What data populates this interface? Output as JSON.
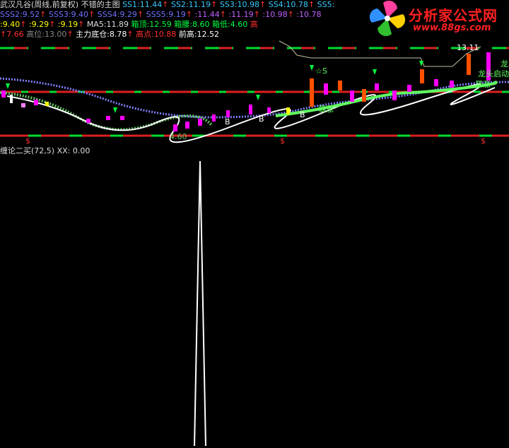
{
  "header": {
    "title": "武汉凡谷(周线,前复权) 不错的主图",
    "ss": [
      {
        "label": "SS1:",
        "value": "11.44"
      },
      {
        "label": "SS2:",
        "value": "11.19"
      },
      {
        "label": "SS3:",
        "value": "10.98"
      },
      {
        "label": "SS4:",
        "value": "10.78"
      },
      {
        "label": "SS5:",
        "value": ""
      }
    ],
    "sss": [
      {
        "label": "SSS2:",
        "value": "9.52"
      },
      {
        "label": "SSS3:",
        "value": "9.40"
      },
      {
        "label": "SSS4:",
        "value": "9.29"
      },
      {
        "label": "SSS5:",
        "value": "9.19"
      },
      {
        "label": ":",
        "value": "11.44"
      },
      {
        "label": ":",
        "value": "11.19"
      },
      {
        "label": ":",
        "value": "10.98"
      },
      {
        "label": ":",
        "value": "10.78"
      }
    ],
    "row3": [
      {
        "label": ":",
        "value": "9.40"
      },
      {
        "label": ":",
        "value": "9.29"
      },
      {
        "label": ":",
        "value": "9.19"
      }
    ],
    "ma5_label": "MA5:",
    "ma5_value": "11.89",
    "box_top_label": "箱顶:",
    "box_top_value": "12.59",
    "box_mid_label": "箱腰:",
    "box_mid_value": "8.60",
    "box_low_label": "箱低:",
    "box_low_value": "4.60",
    "high_short": "高",
    "row4_first": "7.66",
    "high_pos_label": "高位:",
    "high_pos_value": "13.00",
    "main_bottom_label": "主力底仓:",
    "main_bottom_value": "8.78",
    "high_point_label": "高点:",
    "high_point_value": "10.88",
    "prev_high_label": "前高:",
    "prev_high_value": "12.52",
    "up_arrow": "↑"
  },
  "logo": {
    "name": "分析家公式网",
    "url": "www.88gs.com"
  },
  "annotations": {
    "top_price": "13.11",
    "low_price": "4.60",
    "star_s": "☆S",
    "b_mark": "B",
    "soar": "暴涨",
    "dragon": "龙头启动",
    "dragon_short": "龙",
    "dollar": "$"
  },
  "sub_indicator": {
    "title": "缠论二买(72,5)",
    "xx_label": "XX:",
    "xx_value": "0.00"
  },
  "colors": {
    "background": "#000000",
    "up_red": "#ff3030",
    "green": "#00ff40",
    "magenta": "#ff00ff",
    "white": "#ffffff",
    "yellow": "#ffff00"
  }
}
